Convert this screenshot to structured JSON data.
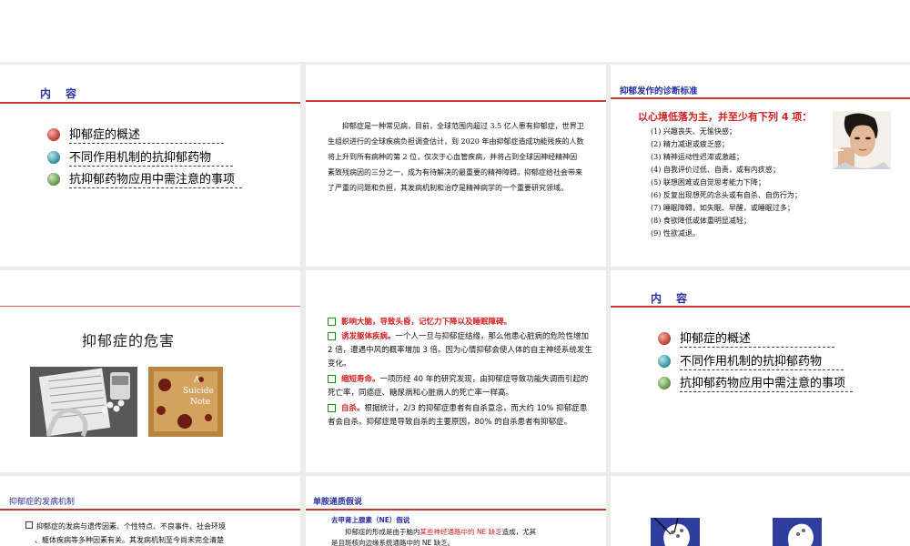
{
  "slide1": {
    "title": "内　容",
    "items": [
      {
        "label": "抑郁症的概述",
        "ball": "red"
      },
      {
        "label": "不同作用机制的抗抑郁药物",
        "ball": "teal"
      },
      {
        "label": "抗抑郁药物应用中需注意的事项",
        "ball": "green"
      }
    ]
  },
  "slide2": {
    "paragraph": "　　抑郁症是一种常见病，目前，全球范围内超过 3.5 亿人患有抑郁症，世界卫生组织进行的全球疾病负担调查估计，到 2020 年由抑郁症造成功能残疾的人数将上升到所有病种的第 2 位，仅次于心血管疾病，并将占到全球因神经精神因素致残病因的三分之一，成为有待解决的最重要的精神障碍。抑郁症给社会带来了严重的问题和负担，其发病机制和治疗是精神病学的一个重要研究领域。"
  },
  "slide3": {
    "title": "抑郁发作的诊断标准",
    "subtitle": "以心境低落为主，并至少有下列 4 项：",
    "criteria": [
      "(1) 兴趣丧失、无愉快感；",
      "(2) 精力减退或疲乏感；",
      "(3) 精神运动性迟滞或激越；",
      "(4) 自我评价过低、自责，或有内疚感；",
      "(5) 联想困难或自觉思考能力下降；",
      "(6) 反复出现想死的念头或有自杀、自伤行为；",
      "(7) 睡眠障碍，如失眠、早醒，或睡眠过多；",
      "(8) 食欲降低或体重明显减轻；",
      "(9) 性欲减退。"
    ]
  },
  "slide4": {
    "title": "抑郁症的危害",
    "note_text_1": "A",
    "note_text_2": "Suicide",
    "note_text_3": "Note"
  },
  "slide5": {
    "items": [
      {
        "red": "影响大脑，导致头昏，记忆力下降以及睡眠障碍。",
        "rest": ""
      },
      {
        "red": "诱发躯体疾病。",
        "rest": "一个人一旦与抑郁症结缘，那么他患心脏病的危险性增加 2 倍，遭遇中风的概率增加 3 倍。因为心情抑郁会使人体的自主神经系统发生变化。"
      },
      {
        "red": "缩短寿命。",
        "rest": "一项历经 40 年的研究发现，由抑郁症导致功能失调而引起的死亡率，同癌症、糖尿病和心脏病人的死亡率一样高。"
      },
      {
        "red": "自杀。",
        "rest": "根据统计，2/3 的抑郁症患者有自杀意念，而大约 10% 抑郁症患者会自杀。抑郁症是导致自杀的主要原因，80% 的自杀患者有抑郁症。"
      }
    ]
  },
  "slide6": {
    "title": "内　容",
    "items": [
      {
        "label": "抑郁症的概述",
        "ball": "red"
      },
      {
        "label": "不同作用机制的抗抑郁药物",
        "ball": "teal"
      },
      {
        "label": "抗抑郁药物应用中需注意的事项",
        "ball": "green"
      }
    ]
  },
  "slide7": {
    "title": "抑郁症的发病机制",
    "line1": "抑郁症的发病与遗传因素、个性特点、不良事件、社会环境",
    "line2": "、躯体疾病等多种因素有关。其发病机制至今尚未完全清楚"
  },
  "slide8": {
    "title": "单胺递质假说",
    "sub": "去甲肾上腺素（NE）假说",
    "line_a": "　　抑郁症的形成是由于脑内",
    "line_a_red": "某些神经通路中的 NE 缺乏",
    "line_a_end": "造成，尤其",
    "line_b": "是且斑核向边缘系统通路中的 NE 缺乏。"
  },
  "colors": {
    "rule_red": "#c63b2f",
    "title_blue": "#2730a0",
    "emphasis_red": "#d21f1f"
  }
}
